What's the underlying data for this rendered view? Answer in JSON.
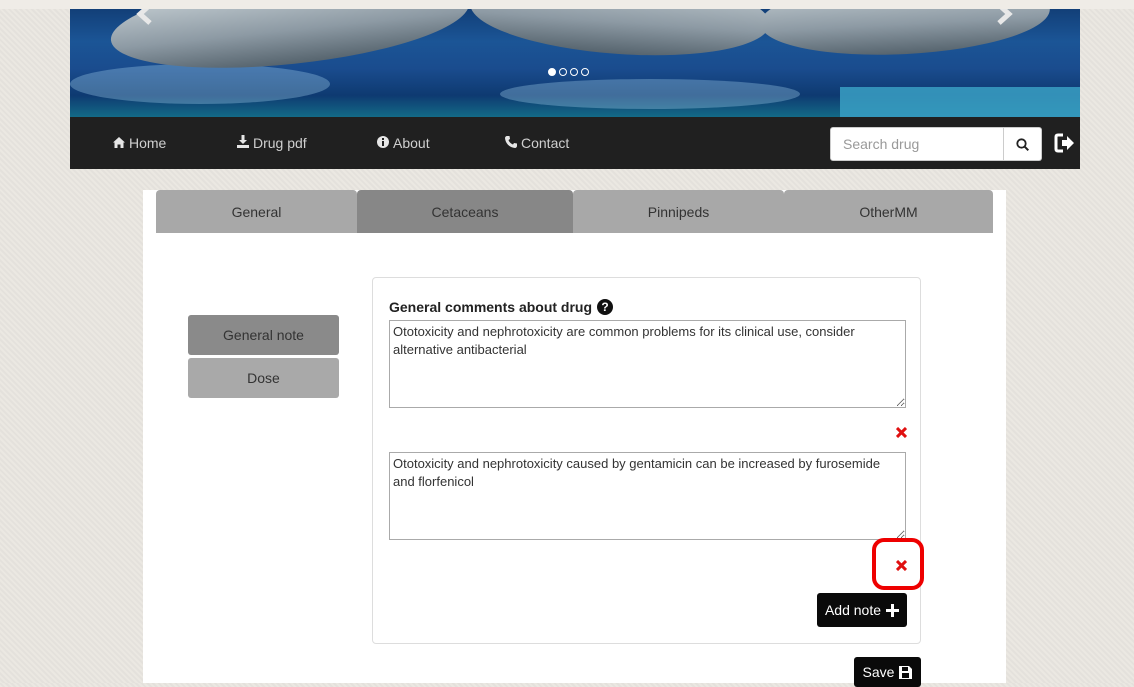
{
  "carousel": {
    "prev_icon": "chevron-left-icon",
    "next_icon": "chevron-right-icon",
    "slide_count": 4,
    "active_slide": 1
  },
  "nav": {
    "home": "Home",
    "drug_pdf": "Drug pdf",
    "about": "About",
    "contact": "Contact",
    "search_placeholder": "Search drug",
    "icons": [
      "home-icon",
      "download-icon",
      "info-icon",
      "phone-icon",
      "search-icon",
      "logout-icon"
    ]
  },
  "tabs": [
    {
      "label": "General"
    },
    {
      "label": "Cetaceans"
    },
    {
      "label": "Pinnipeds"
    },
    {
      "label": "OtherMM"
    }
  ],
  "sidebar": {
    "items": [
      {
        "label": "General note"
      },
      {
        "label": "Dose"
      }
    ]
  },
  "notes": {
    "label": "General comments about drug",
    "help_icon": "question-circle-icon",
    "delete_icon": "remove-icon",
    "items": [
      {
        "text": "Ototoxicity and nephrotoxicity are common problems for its clinical use, consider alternative antibacterial"
      },
      {
        "text": "Ototoxicity and nephrotoxicity caused by gentamicin can be increased by furosemide and florfenicol"
      }
    ],
    "add_label": "Add note",
    "add_icon": "plus-icon"
  },
  "save": {
    "label": "Save",
    "icon": "floppy-disk-icon"
  },
  "colors": {
    "navbar": "#202020",
    "tab_active": "#878787",
    "tab_inactive": "#a8a8a8",
    "delete": "#e01010",
    "highlight": "#ee0000",
    "button": "#0a0a0a"
  }
}
